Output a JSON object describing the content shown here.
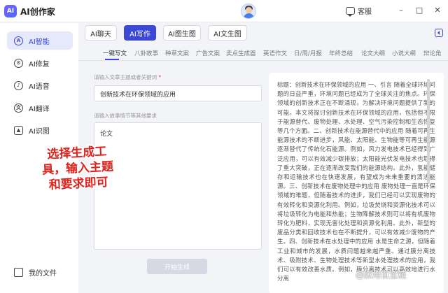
{
  "app": {
    "logo_mark": "AI",
    "title": "AI创作家",
    "service_label": "客服",
    "window_controls": [
      "–",
      "□",
      "✕"
    ]
  },
  "colors": {
    "accent": "#3b48d6",
    "annotation": "#e0221b"
  },
  "sidebar": {
    "items": [
      {
        "label": "AI智能",
        "icon": "ai-chip-icon",
        "active": true
      },
      {
        "label": "AI修复",
        "icon": "wrench-icon",
        "active": false
      },
      {
        "label": "AI语音",
        "icon": "microphone-icon",
        "active": false
      },
      {
        "label": "AI翻译",
        "icon": "translate-icon",
        "active": false
      },
      {
        "label": "AI识图",
        "icon": "image-icon",
        "active": false
      }
    ],
    "footer": {
      "label": "我的文件",
      "icon": "folder-icon"
    }
  },
  "main_tabs": [
    {
      "label": "AI聊天",
      "active": false
    },
    {
      "label": "AI写作",
      "active": true
    },
    {
      "label": "AI图生图",
      "active": false
    },
    {
      "label": "AI文生图",
      "active": false
    }
  ],
  "sub_tabs": [
    {
      "label": "一键写文",
      "active": true
    },
    {
      "label": "八卦故事",
      "active": false
    },
    {
      "label": "种草文案",
      "active": false
    },
    {
      "label": "广告文案",
      "active": false
    },
    {
      "label": "卖点生成器",
      "active": false
    },
    {
      "label": "英语作文",
      "active": false
    },
    {
      "label": "日/周/月报",
      "active": false
    },
    {
      "label": "年终总结",
      "active": false
    },
    {
      "label": "论文大纲",
      "active": false
    },
    {
      "label": "小说大纲",
      "active": false
    },
    {
      "label": "辩论角",
      "active": false
    }
  ],
  "form": {
    "topic_label": "请输入文章主题或者关键词",
    "topic_required_mark": "*",
    "topic_value": "创新技术在环保领域的应用",
    "requirements_label": "请输入故事情节等其他要求",
    "requirements_value": "论文",
    "generate_label": "开始生成"
  },
  "output": {
    "text": "标题：创新技术在环保领域的应用 一、引言 随着全球环境问题的日益严重，环境问题已经成为了全球关注的焦点。环保领域的创新技术正在不断涌现，为解决环境问题提供了新的可能。本文将探讨创新技术在环保领域的应用，包括但不限于能源替代、废物处理、水处理、空气污染控制和生态恢复等几个方面。二、创新技术在能源替代中的应用 随着可再生能源技术的不断进步，风能、太阳能、生物能等可再生能源逐渐替代了传统化石能源。例如，风力发电技术已经得到广泛应用，可以有效减少碳排放；太阳能光伏发电技术也取得了重大突破，正在逐渐改变我们的能源结构。此外，氢能储存和运输技术也在快速发展，有望成为未来重要的清洁能源。三、创新技术在废物处理中的应用 废物处理一直是环保领域的难题，但随着技术的进步，我们已经可以实现废物的有效转化和资源化利用。例如，垃圾焚烧和资源化技术可以将垃圾转化为电能和热能；生物降解技术则可以将有机废物转化为肥料，实现无害化处理和资源化利用。此外，新型的废品分类和回收技术也在不断提升，可以有效减少废物的产生。四、创新技术在水处理中的应用 水是生命之源，但随着工业和城市的发展，水质问题越来越严重。通过膜分离技术、吸附技术、生物处理技术等新型水处理技术的应用，我们可以有效改善水质。例如，膜分离技术可以高效地进行水分离"
  },
  "annotation": {
    "lines": [
      "选择生成工",
      "具，输入主题",
      "和要求即可"
    ]
  },
  "watermark": "@应用百宝箱"
}
